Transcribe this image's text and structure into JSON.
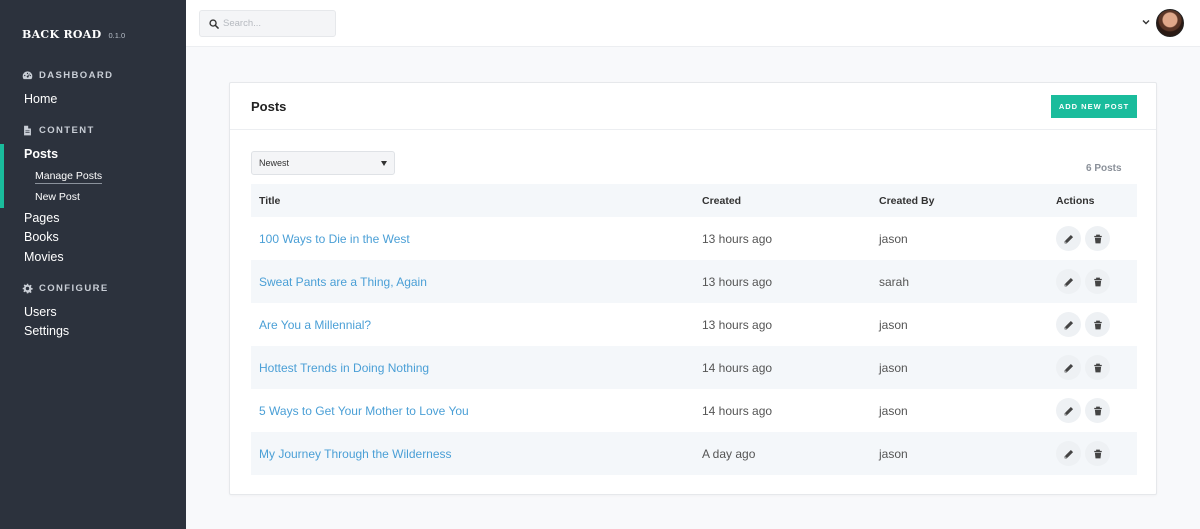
{
  "brand": {
    "name": "BACK ROAD",
    "version": "0.1.0"
  },
  "sidebar": {
    "sections": [
      {
        "label": "DASHBOARD",
        "icon": "dashboard-icon"
      },
      {
        "label": "CONTENT",
        "icon": "file-icon"
      },
      {
        "label": "CONFIGURE",
        "icon": "gear-icon"
      }
    ],
    "items": {
      "home": "Home",
      "posts": "Posts",
      "manage_posts": "Manage Posts",
      "new_post": "New Post",
      "pages": "Pages",
      "books": "Books",
      "movies": "Movies",
      "users": "Users",
      "settings": "Settings"
    },
    "accent": "#1abc9c"
  },
  "search": {
    "placeholder": "Search..."
  },
  "card": {
    "title": "Posts",
    "add_button": "ADD NEW POST",
    "sort": {
      "selected": "Newest"
    },
    "count": "6 Posts"
  },
  "table": {
    "headers": {
      "title": "Title",
      "created": "Created",
      "created_by": "Created By",
      "actions": "Actions"
    },
    "rows": [
      {
        "title": "100 Ways to Die in the West",
        "created": "13 hours ago",
        "by": "jason"
      },
      {
        "title": "Sweat Pants are a Thing, Again",
        "created": "13 hours ago",
        "by": "sarah"
      },
      {
        "title": "Are You a Millennial?",
        "created": "13 hours ago",
        "by": "jason"
      },
      {
        "title": "Hottest Trends in Doing Nothing",
        "created": "14 hours ago",
        "by": "jason"
      },
      {
        "title": "5 Ways to Get Your Mother to Love You",
        "created": "14 hours ago",
        "by": "jason"
      },
      {
        "title": "My Journey Through the Wilderness",
        "created": "A day ago",
        "by": "jason"
      }
    ]
  },
  "colors": {
    "link": "#4a9fd6",
    "sidebar_bg": "#2c323d",
    "button": "#1abc9c"
  }
}
